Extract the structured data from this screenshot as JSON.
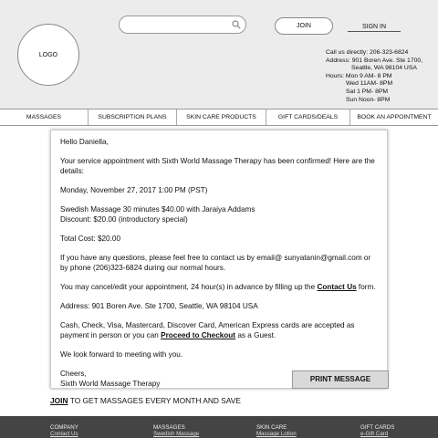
{
  "header": {
    "logo_text": "LOGO",
    "join_label": "JOIN",
    "signin_label": "SIGN IN",
    "contact": {
      "call": "Call us directly: 206-323-6824",
      "address_line1": "Address: 901 Boren Ave. Ste 1700,",
      "address_line2": "Seattle, WA 98104 USA",
      "hours_line1": "Hours: Mon 9 AM- 8 PM",
      "hours_line2": "Wed 11AM- 8PM",
      "hours_line3": "Sat   1 PM- 8PM",
      "hours_line4": "Sun  Noon- 8PM"
    }
  },
  "nav": {
    "items": [
      {
        "label": "MASSAGES"
      },
      {
        "label": "SUBSCRIPTION PLANS"
      },
      {
        "label": "SKIN CARE PRODUCTS"
      },
      {
        "label": "GIFT CARDS/DEALS"
      },
      {
        "label": "BOOK AN APPOINTMENT"
      }
    ]
  },
  "email": {
    "greeting": "Hello Daniella,",
    "intro": "Your service appointment with Sixth World Massage Therapy has been confirmed! Here are   the details:",
    "datetime": "Monday, November 27, 2017 1:00 PM (PST)",
    "service_line": "Swedish Massage  30 minutes $40.00 with Jaraiya Addams",
    "discount_line": "Discount: $20.00 (introductory special)",
    "total": "Total Cost: $20.00",
    "questions": "If you have any questions, please feel free to contact us by email@ sunyatanin@gmail.com or by phone (206)323-6824 during our normal hours.",
    "cancel_before": "You may cancel/edit your appointment, 24 hour(s) in advance by filling up the ",
    "contact_us_link": "Contact Us",
    "cancel_after": "  form.",
    "address": "Address: 901 Boren Ave. Ste 1700, Seattle, WA 98104 USA",
    "payment_before": "Cash, Check, Visa, Mastercard, Discover Card, American Express cards are accepted as payment in person or you can ",
    "checkout_link": "Proceed to Checkout",
    "payment_after": " as a Guest.",
    "closing": "We look forward to meeting with you.",
    "signoff1": "Cheers,",
    "signoff2": "Sixth World Massage Therapy",
    "print_label": "PRINT MESSAGE"
  },
  "join_promo": {
    "link": "JOIN",
    "rest": " TO GET MASSAGES EVERY MONTH AND SAVE"
  },
  "footer": {
    "columns": [
      {
        "title": "COMPANY",
        "sub": "Contact Us"
      },
      {
        "title": "MASSAGES",
        "sub": "Swedish Massage"
      },
      {
        "title": "SKIN CARE",
        "sub": "Massage Lotion"
      },
      {
        "title": "GIFT CARDS",
        "sub": "e-Gift Card"
      }
    ]
  }
}
